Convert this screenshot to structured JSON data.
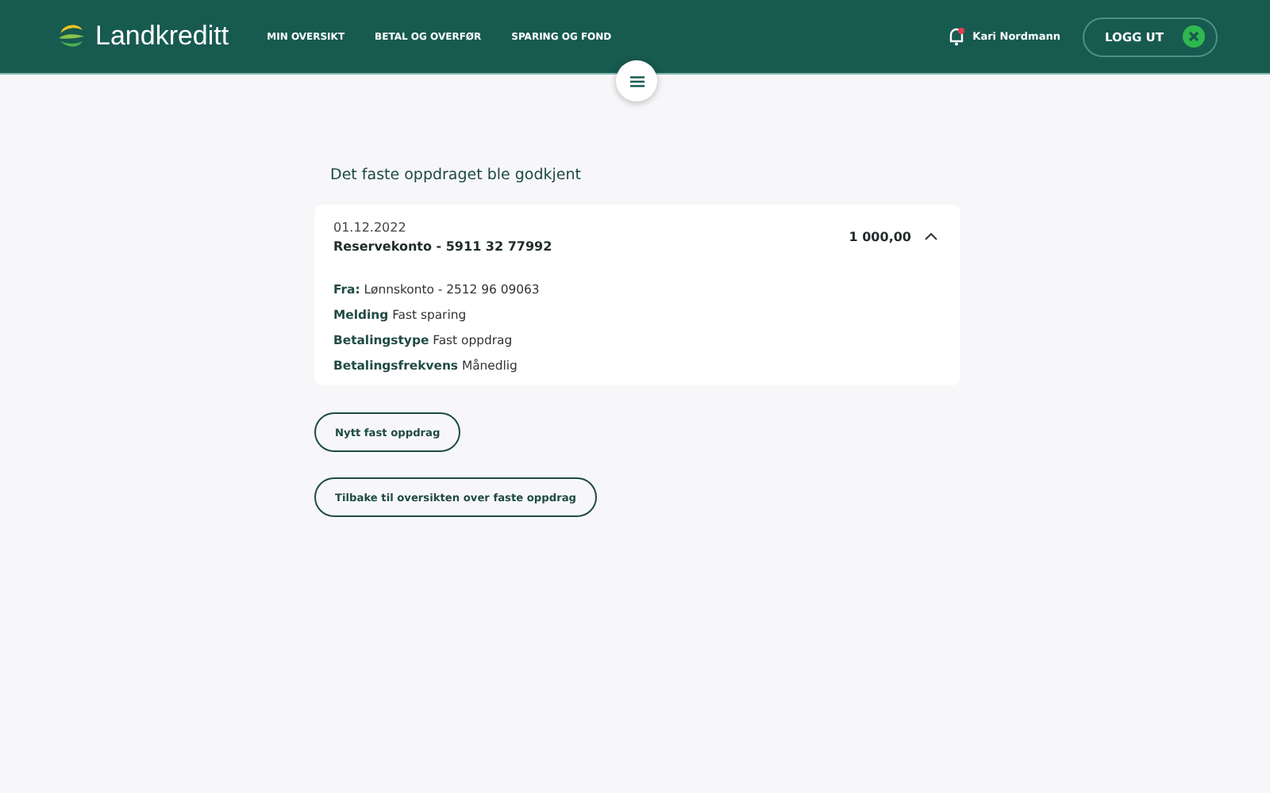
{
  "header": {
    "logo": "Landkreditt",
    "nav": [
      {
        "label": "MIN OVERSIKT"
      },
      {
        "label": "BETAL OG OVERFØR"
      },
      {
        "label": "SPARING OG FOND"
      }
    ],
    "user": "Kari Nordmann",
    "logout": "LOGG UT"
  },
  "heading": "Det faste oppdraget ble godkjent",
  "payment": {
    "date": "01.12.2022",
    "account": "Reservekonto - 5911 32 77992",
    "amount": "1 000,00",
    "expanded": true,
    "details": [
      "**Fra:** Lønnskonto - 2512 96 09063",
      "**Melding** Fast sparing",
      "**Betalingstype** Fast oppdrag",
      "**Betalingsfrekvens** Månedlig"
    ]
  },
  "buttons": [
    "Nytt fast oppdrag",
    "Tilbake til oversikten over faste oppdrag"
  ]
}
